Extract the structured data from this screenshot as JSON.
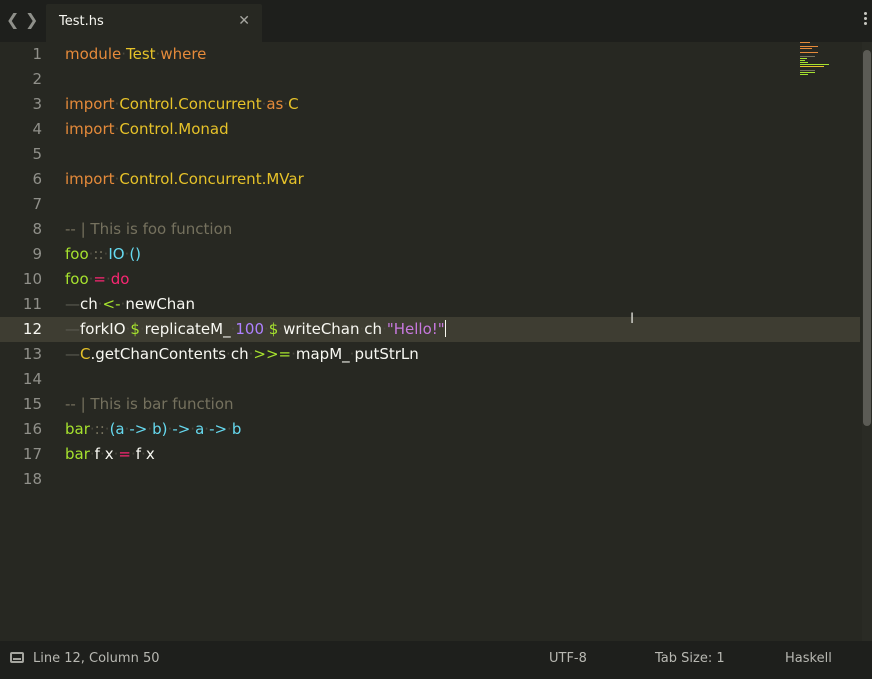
{
  "tab": {
    "title": "Test.hs",
    "close": "✕"
  },
  "nav": {
    "back": "❮",
    "forward": "❯"
  },
  "colors": {
    "background": "#272822",
    "currentLine": "#3e3d32",
    "keyword": "#e58a3a",
    "module": "#e6c229",
    "function": "#a6e22e",
    "type": "#66d9ef",
    "number": "#ae81ff",
    "string": "#c678dd",
    "comment": "#75715e"
  },
  "lines": [
    {
      "n": "1",
      "tokens": [
        [
          "kwo",
          "module"
        ],
        [
          "dot",
          "·"
        ],
        [
          "mod",
          "Test"
        ],
        [
          "dot",
          "·"
        ],
        [
          "kwo",
          "where"
        ]
      ]
    },
    {
      "n": "2",
      "tokens": []
    },
    {
      "n": "3",
      "tokens": [
        [
          "kwo",
          "import"
        ],
        [
          "dot",
          "·"
        ],
        [
          "mod",
          "Control.Concurrent"
        ],
        [
          "dot",
          "·"
        ],
        [
          "kwo",
          "as"
        ],
        [
          "dot",
          "·"
        ],
        [
          "mod",
          "C"
        ]
      ]
    },
    {
      "n": "4",
      "tokens": [
        [
          "kwo",
          "import"
        ],
        [
          "dot",
          "·"
        ],
        [
          "mod",
          "Control.Monad"
        ]
      ]
    },
    {
      "n": "5",
      "tokens": []
    },
    {
      "n": "6",
      "tokens": [
        [
          "kwo",
          "import"
        ],
        [
          "dot",
          "·"
        ],
        [
          "mod",
          "Control.Concurrent.MVar"
        ]
      ]
    },
    {
      "n": "7",
      "tokens": []
    },
    {
      "n": "8",
      "tokens": [
        [
          "cm",
          "-- | This is foo function"
        ]
      ]
    },
    {
      "n": "9",
      "tokens": [
        [
          "fn",
          "foo"
        ],
        [
          "dot",
          "·"
        ],
        [
          "cm",
          "::"
        ],
        [
          "dot",
          "·"
        ],
        [
          "ty",
          "IO"
        ],
        [
          "dot",
          "·"
        ],
        [
          "ty",
          "()"
        ]
      ]
    },
    {
      "n": "10",
      "tokens": [
        [
          "fn",
          "foo"
        ],
        [
          "dot",
          "·"
        ],
        [
          "op",
          "="
        ],
        [
          "dot",
          "·"
        ],
        [
          "op",
          "do"
        ]
      ]
    },
    {
      "n": "11",
      "tokens": [
        [
          "guide",
          "—"
        ],
        [
          "",
          "ch"
        ],
        [
          "dot",
          "·"
        ],
        [
          "fn",
          "<-"
        ],
        [
          "dot",
          "·"
        ],
        [
          "",
          "newChan"
        ]
      ]
    },
    {
      "n": "12",
      "tokens": [
        [
          "guide",
          "—"
        ],
        [
          "",
          "forkIO"
        ],
        [
          "dot",
          "·"
        ],
        [
          "fn",
          "$"
        ],
        [
          "dot",
          "·"
        ],
        [
          "",
          "replicateM_"
        ],
        [
          "dot",
          "·"
        ],
        [
          "num",
          "100"
        ],
        [
          "dot",
          "·"
        ],
        [
          "fn",
          "$"
        ],
        [
          "dot",
          "·"
        ],
        [
          "",
          "writeChan"
        ],
        [
          "dot",
          "·"
        ],
        [
          "",
          "ch"
        ],
        [
          "dot",
          "·"
        ],
        [
          "str",
          "\"Hello!\""
        ]
      ]
    },
    {
      "n": "13",
      "tokens": [
        [
          "guide",
          "—"
        ],
        [
          "mod",
          "C"
        ],
        [
          "",
          "."
        ],
        [
          "",
          "getChanContents"
        ],
        [
          "dot",
          "·"
        ],
        [
          "",
          "ch"
        ],
        [
          "dot",
          "·"
        ],
        [
          "fn",
          ">>="
        ],
        [
          "dot",
          "·"
        ],
        [
          "",
          "mapM_"
        ],
        [
          "dot",
          "·"
        ],
        [
          "",
          "putStrLn"
        ]
      ]
    },
    {
      "n": "14",
      "tokens": []
    },
    {
      "n": "15",
      "tokens": [
        [
          "cm",
          "-- | This is bar function"
        ]
      ]
    },
    {
      "n": "16",
      "tokens": [
        [
          "fn",
          "bar"
        ],
        [
          "dot",
          "·"
        ],
        [
          "cm",
          "::"
        ],
        [
          "dot",
          "·"
        ],
        [
          "ty",
          "(a"
        ],
        [
          "dot",
          "·"
        ],
        [
          "ty",
          "->"
        ],
        [
          "dot",
          "·"
        ],
        [
          "ty",
          "b)"
        ],
        [
          "dot",
          "·"
        ],
        [
          "ty",
          "->"
        ],
        [
          "dot",
          "·"
        ],
        [
          "ty",
          "a"
        ],
        [
          "dot",
          "·"
        ],
        [
          "ty",
          "->"
        ],
        [
          "dot",
          "·"
        ],
        [
          "ty",
          "b"
        ]
      ]
    },
    {
      "n": "17",
      "tokens": [
        [
          "fn",
          "bar"
        ],
        [
          "dot",
          "·"
        ],
        [
          "",
          "f"
        ],
        [
          "dot",
          "·"
        ],
        [
          "",
          "x"
        ],
        [
          "dot",
          "·"
        ],
        [
          "op",
          "="
        ],
        [
          "dot",
          "·"
        ],
        [
          "",
          "f"
        ],
        [
          "dot",
          "·"
        ],
        [
          "",
          "x"
        ]
      ]
    },
    {
      "n": "18",
      "tokens": []
    }
  ],
  "currentLine": 12,
  "status": {
    "position": "Line 12, Column 50",
    "encoding": "UTF-8",
    "tab_size": "Tab Size: 1",
    "syntax": "Haskell"
  }
}
